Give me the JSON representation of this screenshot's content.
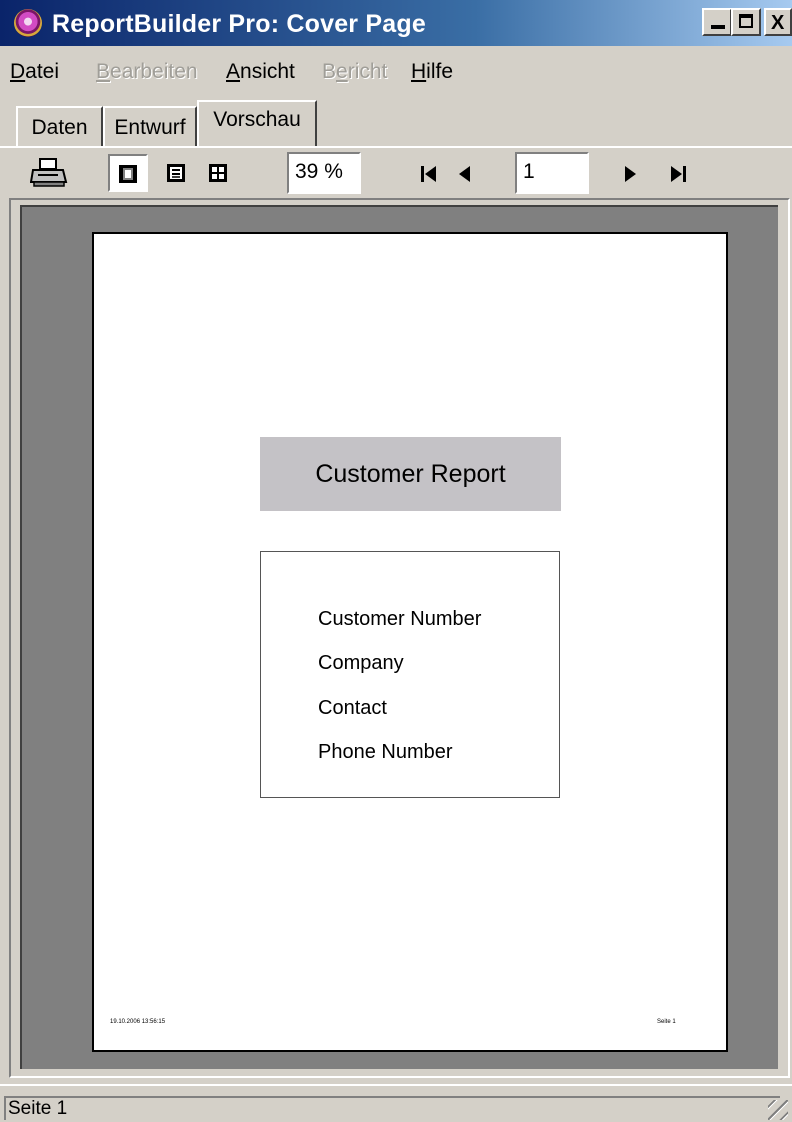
{
  "window": {
    "title": "ReportBuilder Pro: Cover Page",
    "controls": {
      "minimize": "_",
      "maximize": "□",
      "close": "X"
    }
  },
  "menu": [
    {
      "label": "Datei",
      "underline": "D",
      "rest": "atei",
      "disabled": false
    },
    {
      "label": "Bearbeiten",
      "underline": "B",
      "rest": "earbeiten",
      "disabled": true
    },
    {
      "label": "Ansicht",
      "underline": "A",
      "rest": "nsicht",
      "disabled": false
    },
    {
      "label": "Bericht",
      "underline_prefix": "B",
      "underline": "e",
      "rest": "richt",
      "disabled": true
    },
    {
      "label": "Hilfe",
      "underline": "H",
      "rest": "ilfe",
      "disabled": false
    }
  ],
  "tabs": [
    {
      "label": "Daten",
      "active": false
    },
    {
      "label": "Entwurf",
      "active": false
    },
    {
      "label": "Vorschau",
      "active": true
    }
  ],
  "toolbar": {
    "print_icon": "printer-icon",
    "view_icons": [
      "whole-page-icon",
      "page-width-icon",
      "100-percent-icon"
    ],
    "zoom_value": "39 %",
    "nav": {
      "first": "⏮",
      "prev": "◀",
      "next": "▶",
      "last": "⏭"
    },
    "page_value": "1"
  },
  "report": {
    "title": "Customer Report",
    "fields": [
      "Customer Number",
      "Company",
      "Contact",
      "Phone Number"
    ],
    "footer_left": "19.10.2006 13:56:15",
    "footer_right": "Seite 1"
  },
  "status": {
    "text": "Seite 1"
  },
  "colors": {
    "titlebar_start": "#0a246a",
    "titlebar_end": "#a6caf0",
    "window_face": "#d4d0c8",
    "preview_bg": "#808080",
    "title_band": "#c4c2c6"
  }
}
